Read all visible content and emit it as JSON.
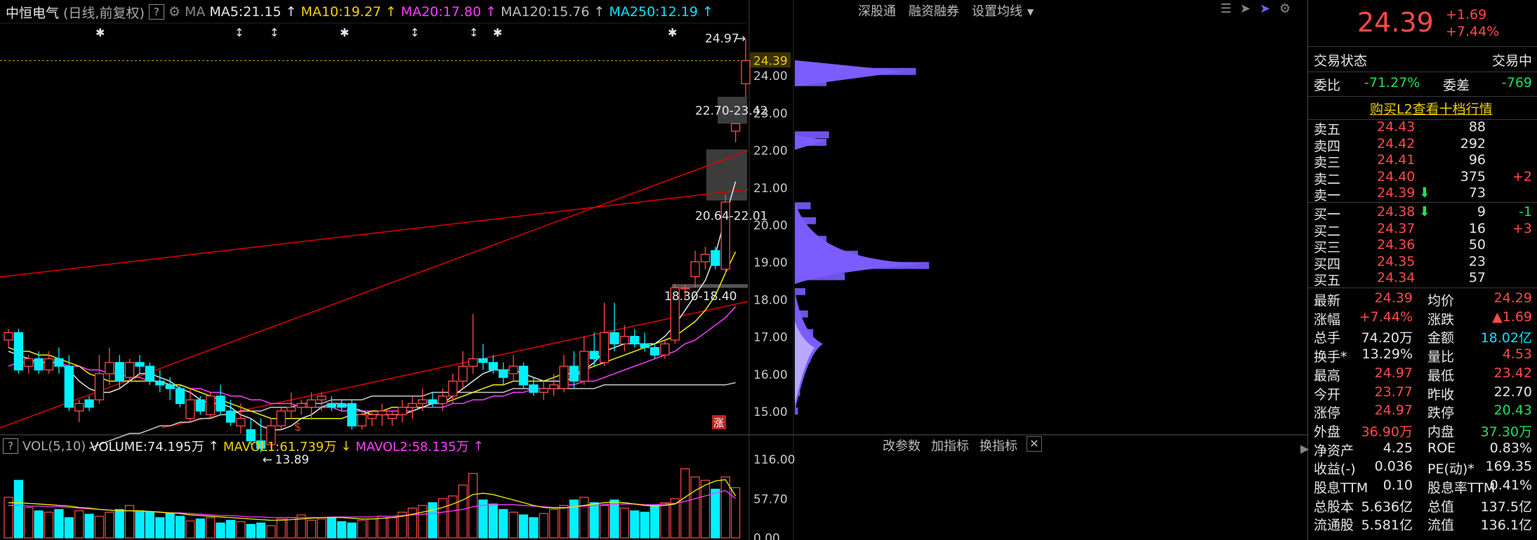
{
  "stock": {
    "name": "中恒电气",
    "mode": "(日线,前复权)",
    "help": "?"
  },
  "header": {
    "ma_label": "MA",
    "ma5": "MA5:21.15",
    "ma10": "MA10:19.27",
    "ma20": "MA20:17.80",
    "ma120": "MA120:15.76",
    "ma250": "MA250:12.19",
    "arrow_up": "↑",
    "buttons": [
      "深股通",
      "融资融券",
      "设置均线"
    ]
  },
  "volume_header": {
    "label": "VOL(5,10)",
    "volume": "VOLUME:74.195万",
    "mavol1": "MAVOL1:61.739万",
    "mavol2": "MAVOL2:58.135万",
    "arrow_up": "↑",
    "arrow_down": "↓",
    "buttons": [
      "改参数",
      "加指标",
      "换指标"
    ]
  },
  "colors": {
    "up": "#ff4a4a",
    "down": "#00f0ff",
    "ma5": "#e6e6e6",
    "ma10": "#f0f000",
    "ma20": "#ff3cff",
    "ma120": "#c8c8c8",
    "trend": "#e00000",
    "profile": "#7b5cff"
  },
  "chart_data": {
    "type": "candlestick",
    "price_axis": {
      "labels": [
        "24.00",
        "23.00",
        "22.00",
        "21.00",
        "20.00",
        "19.00",
        "18.00",
        "17.00",
        "16.00",
        "15.00"
      ],
      "current": "24.39",
      "ylim": [
        14.55,
        25.3
      ]
    },
    "volume_axis": {
      "labels": [
        "116.00",
        "57.70",
        "0.00"
      ],
      "ylim": [
        0,
        116
      ]
    },
    "annotations": {
      "high": "24.97",
      "low": "13.89",
      "zone1": "22.70-23.42",
      "zone2": "20.64-22.01",
      "zone3": "18.30-18.40"
    },
    "markers": {
      "limit_up": "涨",
      "dividend": "$"
    },
    "candles": [
      {
        "o": 16.9,
        "h": 17.2,
        "l": 16.7,
        "c": 17.1
      },
      {
        "o": 17.1,
        "h": 17.2,
        "l": 16.0,
        "c": 16.1
      },
      {
        "o": 16.2,
        "h": 16.5,
        "l": 16.0,
        "c": 16.4
      },
      {
        "o": 16.4,
        "h": 16.6,
        "l": 16.0,
        "c": 16.1
      },
      {
        "o": 16.1,
        "h": 16.6,
        "l": 16.0,
        "c": 16.4
      },
      {
        "o": 16.4,
        "h": 16.7,
        "l": 16.0,
        "c": 16.2
      },
      {
        "o": 16.2,
        "h": 16.5,
        "l": 15.0,
        "c": 15.1
      },
      {
        "o": 15.0,
        "h": 15.3,
        "l": 14.7,
        "c": 15.2
      },
      {
        "o": 15.3,
        "h": 15.4,
        "l": 15.0,
        "c": 15.1
      },
      {
        "o": 15.3,
        "h": 16.5,
        "l": 15.2,
        "c": 16.0
      },
      {
        "o": 16.0,
        "h": 16.7,
        "l": 15.7,
        "c": 16.3
      },
      {
        "o": 16.3,
        "h": 16.5,
        "l": 15.6,
        "c": 15.8
      },
      {
        "o": 15.9,
        "h": 16.4,
        "l": 15.8,
        "c": 16.3
      },
      {
        "o": 16.3,
        "h": 16.5,
        "l": 16.0,
        "c": 16.2
      },
      {
        "o": 16.2,
        "h": 16.3,
        "l": 15.7,
        "c": 15.8
      },
      {
        "o": 15.8,
        "h": 16.1,
        "l": 15.5,
        "c": 15.7
      },
      {
        "o": 15.7,
        "h": 15.9,
        "l": 15.3,
        "c": 15.6
      },
      {
        "o": 15.6,
        "h": 15.7,
        "l": 15.1,
        "c": 15.2
      },
      {
        "o": 14.8,
        "h": 15.6,
        "l": 14.7,
        "c": 15.3
      },
      {
        "o": 15.3,
        "h": 15.4,
        "l": 14.9,
        "c": 15.0
      },
      {
        "o": 14.9,
        "h": 15.5,
        "l": 14.8,
        "c": 15.4
      },
      {
        "o": 15.4,
        "h": 15.7,
        "l": 14.9,
        "c": 15.0
      },
      {
        "o": 15.0,
        "h": 15.3,
        "l": 14.6,
        "c": 14.7
      },
      {
        "o": 14.6,
        "h": 15.2,
        "l": 14.4,
        "c": 14.8
      },
      {
        "o": 14.5,
        "h": 14.8,
        "l": 14.1,
        "c": 14.2
      },
      {
        "o": 14.2,
        "h": 14.8,
        "l": 13.89,
        "c": 14.0
      },
      {
        "o": 14.1,
        "h": 14.8,
        "l": 14.0,
        "c": 14.6
      },
      {
        "o": 14.6,
        "h": 15.1,
        "l": 14.5,
        "c": 15.0
      },
      {
        "o": 15.0,
        "h": 15.5,
        "l": 14.8,
        "c": 15.1
      },
      {
        "o": 15.1,
        "h": 15.3,
        "l": 14.9,
        "c": 15.2
      },
      {
        "o": 15.1,
        "h": 15.5,
        "l": 14.8,
        "c": 15.3
      },
      {
        "o": 15.3,
        "h": 15.5,
        "l": 15.0,
        "c": 15.4
      },
      {
        "o": 15.2,
        "h": 15.4,
        "l": 15.0,
        "c": 15.1
      },
      {
        "o": 15.2,
        "h": 15.3,
        "l": 15.0,
        "c": 15.1
      },
      {
        "o": 15.2,
        "h": 15.3,
        "l": 14.5,
        "c": 14.6
      },
      {
        "o": 14.6,
        "h": 15.0,
        "l": 14.5,
        "c": 14.9
      },
      {
        "o": 14.8,
        "h": 15.0,
        "l": 14.6,
        "c": 14.9
      },
      {
        "o": 14.9,
        "h": 15.2,
        "l": 14.6,
        "c": 15.0
      },
      {
        "o": 14.8,
        "h": 15.0,
        "l": 14.6,
        "c": 14.9
      },
      {
        "o": 14.9,
        "h": 15.3,
        "l": 14.7,
        "c": 15.1
      },
      {
        "o": 15.1,
        "h": 15.4,
        "l": 14.8,
        "c": 15.2
      },
      {
        "o": 15.2,
        "h": 15.6,
        "l": 15.0,
        "c": 15.3
      },
      {
        "o": 15.3,
        "h": 15.5,
        "l": 15.1,
        "c": 15.2
      },
      {
        "o": 15.2,
        "h": 15.6,
        "l": 15.0,
        "c": 15.4
      },
      {
        "o": 15.4,
        "h": 16.0,
        "l": 15.2,
        "c": 15.8
      },
      {
        "o": 15.8,
        "h": 16.6,
        "l": 15.6,
        "c": 16.2
      },
      {
        "o": 16.2,
        "h": 17.6,
        "l": 16.0,
        "c": 16.4
      },
      {
        "o": 16.4,
        "h": 16.8,
        "l": 16.1,
        "c": 16.3
      },
      {
        "o": 16.3,
        "h": 16.5,
        "l": 16.0,
        "c": 16.1
      },
      {
        "o": 16.1,
        "h": 16.3,
        "l": 15.7,
        "c": 15.9
      },
      {
        "o": 16.0,
        "h": 16.5,
        "l": 15.8,
        "c": 16.2
      },
      {
        "o": 16.2,
        "h": 16.3,
        "l": 15.6,
        "c": 15.7
      },
      {
        "o": 15.7,
        "h": 15.9,
        "l": 15.4,
        "c": 15.5
      },
      {
        "o": 15.5,
        "h": 15.8,
        "l": 15.3,
        "c": 15.6
      },
      {
        "o": 15.6,
        "h": 16.0,
        "l": 15.4,
        "c": 15.7
      },
      {
        "o": 15.6,
        "h": 16.5,
        "l": 15.5,
        "c": 16.2
      },
      {
        "o": 16.2,
        "h": 16.6,
        "l": 15.6,
        "c": 15.8
      },
      {
        "o": 15.8,
        "h": 17.0,
        "l": 15.7,
        "c": 16.6
      },
      {
        "o": 16.6,
        "h": 17.1,
        "l": 16.2,
        "c": 16.4
      },
      {
        "o": 16.3,
        "h": 17.9,
        "l": 16.2,
        "c": 17.1
      },
      {
        "o": 17.1,
        "h": 17.9,
        "l": 16.6,
        "c": 16.8
      },
      {
        "o": 16.8,
        "h": 17.3,
        "l": 16.6,
        "c": 17.0
      },
      {
        "o": 17.0,
        "h": 17.2,
        "l": 16.7,
        "c": 16.8
      },
      {
        "o": 16.8,
        "h": 17.1,
        "l": 16.6,
        "c": 16.7
      },
      {
        "o": 16.7,
        "h": 16.8,
        "l": 16.4,
        "c": 16.5
      },
      {
        "o": 16.5,
        "h": 16.9,
        "l": 16.4,
        "c": 16.8
      },
      {
        "o": 16.9,
        "h": 18.4,
        "l": 16.8,
        "c": 18.3
      },
      {
        "o": 18.3,
        "h": 18.4,
        "l": 18.0,
        "c": 18.3
      },
      {
        "o": 18.6,
        "h": 19.3,
        "l": 18.3,
        "c": 19.0
      },
      {
        "o": 19.0,
        "h": 19.4,
        "l": 18.8,
        "c": 19.2
      },
      {
        "o": 19.3,
        "h": 19.4,
        "l": 18.8,
        "c": 18.9
      },
      {
        "o": 18.8,
        "h": 20.8,
        "l": 18.7,
        "c": 20.6
      },
      {
        "o": 22.5,
        "h": 22.7,
        "l": 22.2,
        "c": 22.7
      },
      {
        "o": 23.77,
        "h": 24.97,
        "l": 23.42,
        "c": 24.39
      }
    ],
    "ma": {
      "ma5": [
        16.6,
        16.5,
        16.4,
        16.3,
        16.3,
        16.3,
        16.1,
        15.8,
        15.6,
        15.5,
        15.5,
        15.6,
        15.8,
        16.0,
        16.0,
        15.9,
        15.8,
        15.6,
        15.5,
        15.3,
        15.2,
        15.2,
        15.1,
        14.9,
        14.8,
        14.6,
        14.5,
        14.5,
        14.6,
        14.8,
        14.9,
        15.1,
        15.2,
        15.2,
        15.1,
        15.0,
        14.9,
        14.9,
        14.9,
        14.9,
        15.0,
        15.1,
        15.2,
        15.2,
        15.4,
        15.6,
        15.8,
        16.0,
        16.1,
        16.1,
        16.1,
        16.0,
        15.9,
        15.8,
        15.8,
        15.8,
        15.9,
        16.1,
        16.3,
        16.6,
        16.7,
        16.8,
        16.8,
        16.8,
        16.8,
        17.0,
        17.3,
        17.7,
        18.1,
        18.5,
        19.2,
        20.2,
        21.15
      ],
      "ma10": [
        16.7,
        16.6,
        16.6,
        16.5,
        16.5,
        16.4,
        16.3,
        16.2,
        16.0,
        15.9,
        15.8,
        15.8,
        15.8,
        15.8,
        15.8,
        15.8,
        15.7,
        15.7,
        15.6,
        15.5,
        15.4,
        15.3,
        15.2,
        15.1,
        15.0,
        14.9,
        14.8,
        14.8,
        14.8,
        14.8,
        14.8,
        14.8,
        14.8,
        14.8,
        14.9,
        14.9,
        15.0,
        15.0,
        15.1,
        15.1,
        15.1,
        15.1,
        15.2,
        15.2,
        15.3,
        15.4,
        15.5,
        15.6,
        15.7,
        15.7,
        15.8,
        15.8,
        15.8,
        15.8,
        15.9,
        16.0,
        16.0,
        16.1,
        16.2,
        16.3,
        16.4,
        16.5,
        16.6,
        16.7,
        16.8,
        16.9,
        17.0,
        17.2,
        17.4,
        17.7,
        18.1,
        18.7,
        19.27
      ],
      "ma20": [
        16.2,
        16.3,
        16.3,
        16.3,
        16.3,
        16.3,
        16.2,
        16.2,
        16.1,
        16.1,
        16.0,
        16.0,
        15.9,
        15.9,
        15.8,
        15.8,
        15.7,
        15.7,
        15.6,
        15.6,
        15.5,
        15.5,
        15.4,
        15.4,
        15.3,
        15.3,
        15.2,
        15.2,
        15.2,
        15.1,
        15.1,
        15.1,
        15.1,
        15.0,
        15.0,
        15.0,
        15.0,
        15.0,
        15.0,
        15.0,
        15.0,
        15.1,
        15.1,
        15.1,
        15.2,
        15.2,
        15.3,
        15.3,
        15.4,
        15.4,
        15.5,
        15.5,
        15.6,
        15.6,
        15.6,
        15.7,
        15.7,
        15.8,
        15.8,
        15.9,
        16.0,
        16.1,
        16.2,
        16.3,
        16.4,
        16.5,
        16.6,
        16.8,
        16.9,
        17.1,
        17.3,
        17.5,
        17.8
      ],
      "ma120_start_index": 8,
      "ma120": [
        14.0,
        14.1,
        14.2,
        14.3,
        14.4,
        14.4,
        14.5,
        14.6,
        14.6,
        14.7,
        14.7,
        14.8,
        14.8,
        14.9,
        14.9,
        15.0,
        15.0,
        15.0,
        15.1,
        15.1,
        15.1,
        15.2,
        15.2,
        15.2,
        15.3,
        15.3,
        15.3,
        15.3,
        15.4,
        15.4,
        15.4,
        15.4,
        15.4,
        15.4,
        15.5,
        15.5,
        15.5,
        15.5,
        15.5,
        15.5,
        15.5,
        15.5,
        15.6,
        15.6,
        15.6,
        15.6,
        15.6,
        15.6,
        15.6,
        15.6,
        15.6,
        15.7,
        15.7,
        15.7,
        15.7,
        15.7,
        15.7,
        15.7,
        15.7,
        15.7,
        15.7,
        15.7,
        15.7,
        15.7,
        15.76
      ]
    },
    "volumes": [
      60,
      85,
      45,
      40,
      38,
      42,
      30,
      40,
      35,
      32,
      38,
      42,
      48,
      40,
      38,
      30,
      36,
      32,
      25,
      28,
      30,
      22,
      26,
      24,
      20,
      22,
      18,
      28,
      30,
      34,
      26,
      28,
      30,
      24,
      22,
      26,
      28,
      32,
      30,
      38,
      44,
      48,
      52,
      58,
      62,
      78,
      95,
      56,
      50,
      42,
      38,
      34,
      30,
      36,
      42,
      48,
      56,
      60,
      52,
      48,
      56,
      44,
      40,
      38,
      48,
      52,
      58,
      102,
      90,
      85,
      72,
      90,
      74.2
    ],
    "mavol1": [
      52,
      52,
      51,
      50,
      49,
      48,
      47,
      45,
      44,
      42,
      41,
      40,
      40,
      40,
      39,
      38,
      37,
      36,
      34,
      33,
      32,
      31,
      30,
      29,
      28,
      27,
      26,
      26,
      27,
      28,
      29,
      30,
      30,
      30,
      29,
      28,
      28,
      29,
      30,
      32,
      35,
      38,
      41,
      45,
      50,
      56,
      64,
      66,
      64,
      60,
      56,
      52,
      48,
      45,
      44,
      44,
      46,
      48,
      50,
      52,
      53,
      52,
      50,
      48,
      47,
      48,
      50,
      60,
      70,
      78,
      84,
      86,
      61.7
    ],
    "mavol2": [
      48,
      48,
      47,
      47,
      46,
      46,
      45,
      44,
      43,
      42,
      41,
      40,
      40,
      39,
      39,
      38,
      37,
      37,
      36,
      35,
      34,
      33,
      33,
      32,
      31,
      31,
      30,
      30,
      30,
      30,
      30,
      30,
      31,
      31,
      31,
      31,
      31,
      32,
      32,
      33,
      34,
      35,
      36,
      38,
      40,
      42,
      46,
      48,
      49,
      49,
      49,
      48,
      47,
      46,
      45,
      45,
      46,
      47,
      48,
      49,
      50,
      50,
      50,
      49,
      49,
      50,
      51,
      54,
      58,
      62,
      66,
      70,
      58.1
    ],
    "volume_profile": [
      {
        "price": 24.1,
        "w": 230
      },
      {
        "price": 23.8,
        "w": 60
      },
      {
        "price": 22.4,
        "w": 65
      },
      {
        "price": 22.2,
        "w": 60
      },
      {
        "price": 20.5,
        "w": 30
      },
      {
        "price": 20.1,
        "w": 40
      },
      {
        "price": 19.6,
        "w": 60
      },
      {
        "price": 19.2,
        "w": 120
      },
      {
        "price": 18.9,
        "w": 255
      },
      {
        "price": 18.6,
        "w": 95
      },
      {
        "price": 18.2,
        "w": 20
      },
      {
        "price": 17.6,
        "w": 25
      },
      {
        "price": 17.1,
        "w": 35
      },
      {
        "price": 16.8,
        "w": 40
      },
      {
        "price": 16.4,
        "w": 30
      },
      {
        "price": 16.0,
        "w": 18
      },
      {
        "price": 15.5,
        "w": 10
      },
      {
        "price": 15.0,
        "w": 6
      }
    ]
  },
  "right_panel": {
    "price": "24.39",
    "change": "+1.69",
    "change_pct": "+7.44%",
    "status_label": "交易状态",
    "status": "交易中",
    "weibi_label": "委比",
    "weibi": "-71.27%",
    "weicha_label": "委差",
    "weicha": "-769",
    "l2_link": "购买L2查看十档行情",
    "asks": [
      {
        "label": "卖五",
        "price": "24.43",
        "vol": "88",
        "chg": ""
      },
      {
        "label": "卖四",
        "price": "24.42",
        "vol": "292",
        "chg": ""
      },
      {
        "label": "卖三",
        "price": "24.41",
        "vol": "96",
        "chg": ""
      },
      {
        "label": "卖二",
        "price": "24.40",
        "vol": "375",
        "chg": "+2"
      },
      {
        "label": "卖一",
        "price": "24.39",
        "vol": "73",
        "chg": ""
      }
    ],
    "bids": [
      {
        "label": "买一",
        "price": "24.38",
        "vol": "9",
        "chg": "-1"
      },
      {
        "label": "买二",
        "price": "24.37",
        "vol": "16",
        "chg": "+3"
      },
      {
        "label": "买三",
        "price": "24.36",
        "vol": "50",
        "chg": ""
      },
      {
        "label": "买四",
        "price": "24.35",
        "vol": "23",
        "chg": ""
      },
      {
        "label": "买五",
        "price": "24.34",
        "vol": "57",
        "chg": ""
      }
    ],
    "down_arrow": "⬇",
    "stats": [
      {
        "l1": "最新",
        "v1": "24.39",
        "c1": "red",
        "l2": "均价",
        "v2": "24.29",
        "c2": "red"
      },
      {
        "l1": "涨幅",
        "v1": "+7.44%",
        "c1": "red",
        "l2": "涨跌",
        "v2": "▲1.69",
        "c2": "red"
      },
      {
        "l1": "总手",
        "v1": "74.20万",
        "c1": "wht",
        "l2": "金额",
        "v2": "18.02亿",
        "c2": "cy"
      },
      {
        "l1": "换手*",
        "v1": "13.29%",
        "c1": "wht",
        "l2": "量比",
        "v2": "4.53",
        "c2": "red"
      },
      {
        "l1": "最高",
        "v1": "24.97",
        "c1": "red",
        "l2": "最低",
        "v2": "23.42",
        "c2": "red"
      },
      {
        "l1": "今开",
        "v1": "23.77",
        "c1": "red",
        "l2": "昨收",
        "v2": "22.70",
        "c2": "wht"
      },
      {
        "l1": "涨停",
        "v1": "24.97",
        "c1": "red",
        "l2": "跌停",
        "v2": "20.43",
        "c2": "green"
      },
      {
        "l1": "外盘",
        "v1": "36.90万",
        "c1": "red",
        "l2": "内盘",
        "v2": "37.30万",
        "c2": "green"
      },
      {
        "l1": "净资产",
        "v1": "4.25",
        "c1": "wht",
        "l2": "ROE",
        "v2": "0.83%",
        "c2": "wht"
      },
      {
        "l1": "收益(-)",
        "v1": "0.036",
        "c1": "wht",
        "l2": "PE(动)*",
        "v2": "169.35",
        "c2": "wht"
      },
      {
        "l1": "股息TTM",
        "v1": "0.10",
        "c1": "wht",
        "l2": "股息率TTM",
        "v2": "0.41%",
        "c2": "wht"
      },
      {
        "l1": "总股本",
        "v1": "5.636亿",
        "c1": "wht",
        "l2": "总值",
        "v2": "137.5亿",
        "c2": "wht"
      },
      {
        "l1": "流通股",
        "v1": "5.581亿",
        "c1": "wht",
        "l2": "流值",
        "v2": "136.1亿",
        "c2": "wht"
      }
    ]
  }
}
